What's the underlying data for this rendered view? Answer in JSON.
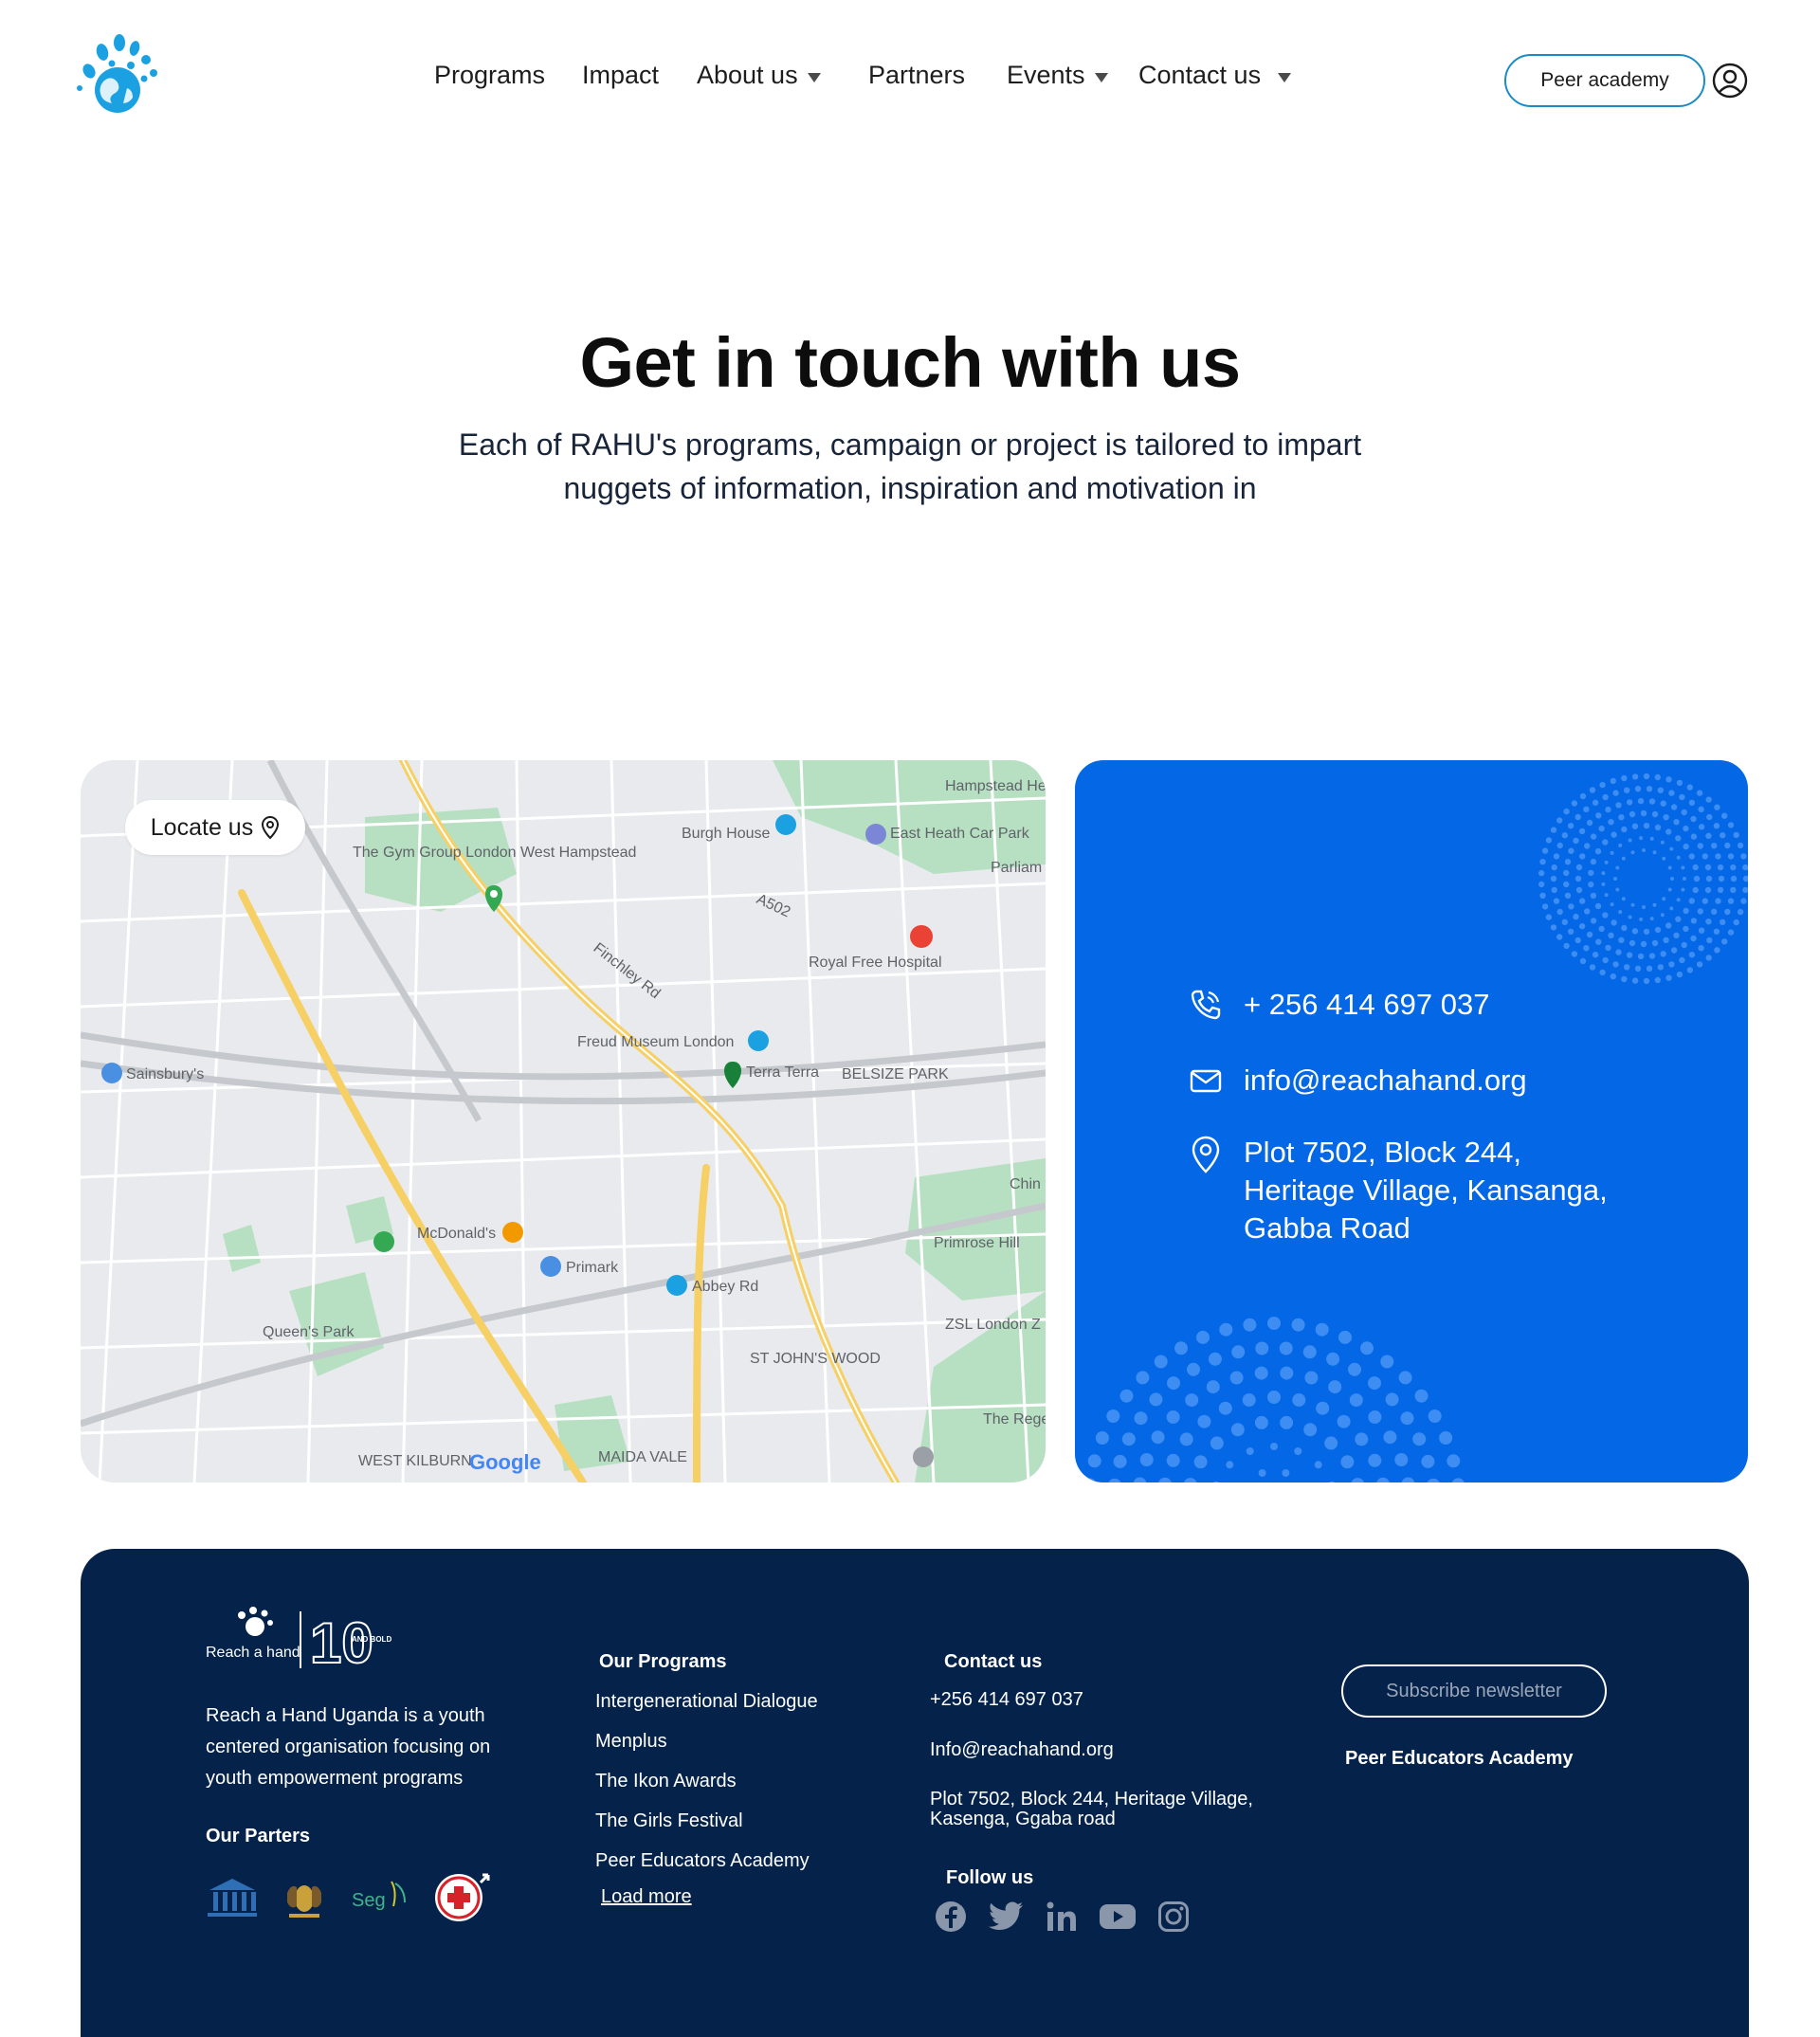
{
  "header": {
    "nav": [
      {
        "label": "Programs",
        "has_caret": false
      },
      {
        "label": "Impact",
        "has_caret": false
      },
      {
        "label": "About us",
        "has_caret": true
      },
      {
        "label": "Partners",
        "has_caret": false
      },
      {
        "label": "Events",
        "has_caret": true
      },
      {
        "label": "Contact us",
        "has_caret": true
      }
    ],
    "peer_academy_label": "Peer academy",
    "user_icon": "user-circle-icon"
  },
  "hero": {
    "title": "Get in touch with us",
    "subtitle": "Each of RAHU's programs, campaign or project is tailored to impart nuggets of information, inspiration and motivation in"
  },
  "map": {
    "locate_label": "Locate us",
    "labels": {
      "hampstead_heath": "Hampstead Heath",
      "burgh_house": "Burgh House",
      "east_heath": "East Heath Car Park",
      "parliament": "Parliam Fiel",
      "gym": "The Gym Group London West Hampstead",
      "royal_free": "Royal Free Hospital",
      "freud": "Freud Museum London",
      "terra": "Terra Terra",
      "belsize": "BELSIZE PARK",
      "sainsburys": "Sainsbury's",
      "mcdonalds": "McDonald's",
      "primark": "Primark",
      "abbey": "Abbey Rd",
      "primrose": "Primrose Hill",
      "zsl": "ZSL London Z",
      "queens_park": "Queen's Park",
      "st_johns": "ST JOHN'S WOOD",
      "maida": "MAIDA VALE",
      "kilburn": "WEST KILBURN",
      "regents": "The Rege Park",
      "chin": "Chin",
      "finchley": "Finchley Rd",
      "a502": "A502",
      "google": "Google"
    }
  },
  "contact": {
    "phone": "+ 256 414 697 037",
    "email": "info@reachahand.org",
    "address": [
      "Plot 7502, Block 244,",
      "Heritage Village, Kansanga,",
      "Gabba Road"
    ]
  },
  "footer": {
    "logo_text": "Reach a hand",
    "badge_text": "AND BOLD",
    "about": "Reach a Hand Uganda is a youth centered organisation focusing on youth empowerment programs",
    "partners_heading": "Our Parters",
    "programs_heading": "Our Programs",
    "programs": [
      "Intergenerational Dialogue",
      "Menplus",
      "The Ikon Awards",
      "The Girls Festival",
      "Peer Educators Academy"
    ],
    "load_more": "Load more",
    "contact_heading": "Contact us",
    "phone": "+256 414 697 037",
    "email": "Info@reachahand.org",
    "address": "Plot 7502, Block 244, Heritage Village, Kasenga, Ggaba road",
    "follow_heading": "Follow us",
    "subscribe_label": "Subscribe newsletter",
    "peer_academy": "Peer Educators Academy",
    "socials": [
      "facebook-icon",
      "twitter-icon",
      "linkedin-icon",
      "youtube-icon",
      "instagram-icon"
    ]
  },
  "colors": {
    "brand_blue": "#0367e6",
    "footer_navy": "#05234a",
    "logo_blue": "#1ba1e2",
    "outline_blue": "#1a8bc7"
  }
}
